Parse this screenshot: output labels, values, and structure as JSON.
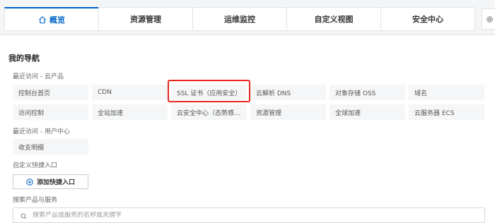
{
  "tabs": [
    {
      "label": "概览",
      "icon": "home-icon",
      "active": true
    },
    {
      "label": "资源管理"
    },
    {
      "label": "运维监控"
    },
    {
      "label": "自定义视图"
    },
    {
      "label": "安全中心"
    }
  ],
  "settings_icon": "gear-icon",
  "nav": {
    "title": "我的导航",
    "recent_cloud_label": "最近访问 - 云产品",
    "recent_cloud": [
      "控制台首页",
      "CDN",
      "SSL 证书（应用安全）",
      "云解析 DNS",
      "对象存储 OSS",
      "域名",
      "访问控制",
      "全站加速",
      "云安全中心（态势感...",
      "资源管理",
      "全球加速",
      "云服务器 ECS"
    ],
    "recent_user_label": "最近访问 - 用户中心",
    "recent_user": [
      "收支明细"
    ],
    "custom_label": "自定义快捷入口",
    "add_button": "添加快捷入口",
    "search_label": "搜索产品与服务",
    "search_placeholder": "搜索产品或服务的名称或关键字"
  },
  "colors": {
    "accent": "#0064c8",
    "highlight": "#e8261c"
  }
}
